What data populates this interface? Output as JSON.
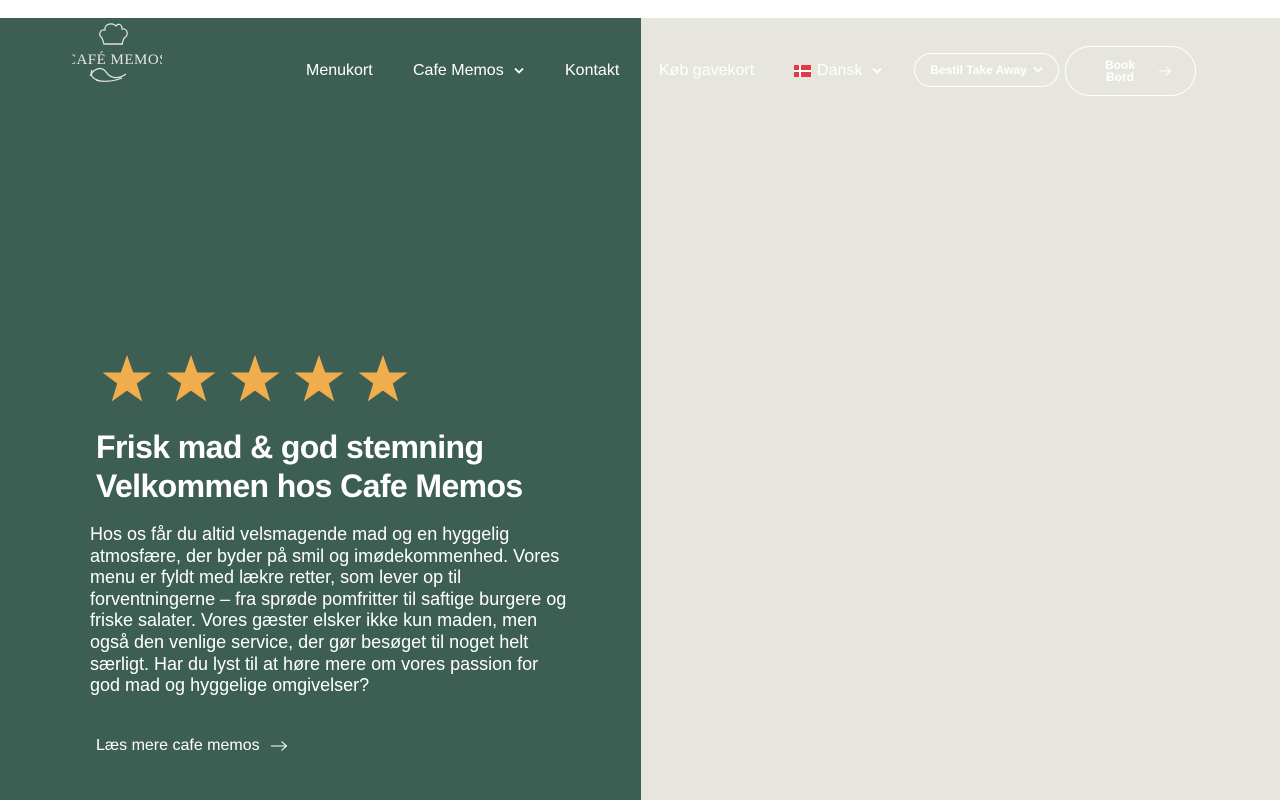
{
  "brand": {
    "logo_text": "CAFÉ MEMOS"
  },
  "nav": {
    "items": [
      {
        "label": "Menukort"
      },
      {
        "label": "Cafe Memos"
      },
      {
        "label": "Kontakt"
      },
      {
        "label": "Køb gavekort"
      }
    ],
    "language": {
      "label": "Dansk",
      "flag_icon": "denmark-flag-icon"
    },
    "takeaway_button": "Bestil Take Away",
    "book_button": "Book Bord"
  },
  "hero": {
    "rating": {
      "stars": 5,
      "max": 5,
      "star_color": "#f0ad4e"
    },
    "headline_line1": "Frisk mad & god stemning",
    "headline_line2": "Velkommen hos Cafe Memos",
    "body": "Hos os får du altid velsmagende mad og en hyggelig atmosfære, der byder på smil og imødekommenhed. Vores menu er fyldt med lækre retter, som lever op til forventningerne – fra sprøde pomfritter til saftige burgere og friske salater. Vores gæster elsker ikke kun maden, men også den venlige service, der gør besøget til noget helt særligt. Har du lyst til at høre mere om vores passion for god mad og hyggelige omgivelser?",
    "read_more": "Læs mere cafe memos"
  },
  "colors": {
    "panel_green": "#3c5e53",
    "panel_beige": "#e7e6de",
    "text": "#ffffff"
  }
}
